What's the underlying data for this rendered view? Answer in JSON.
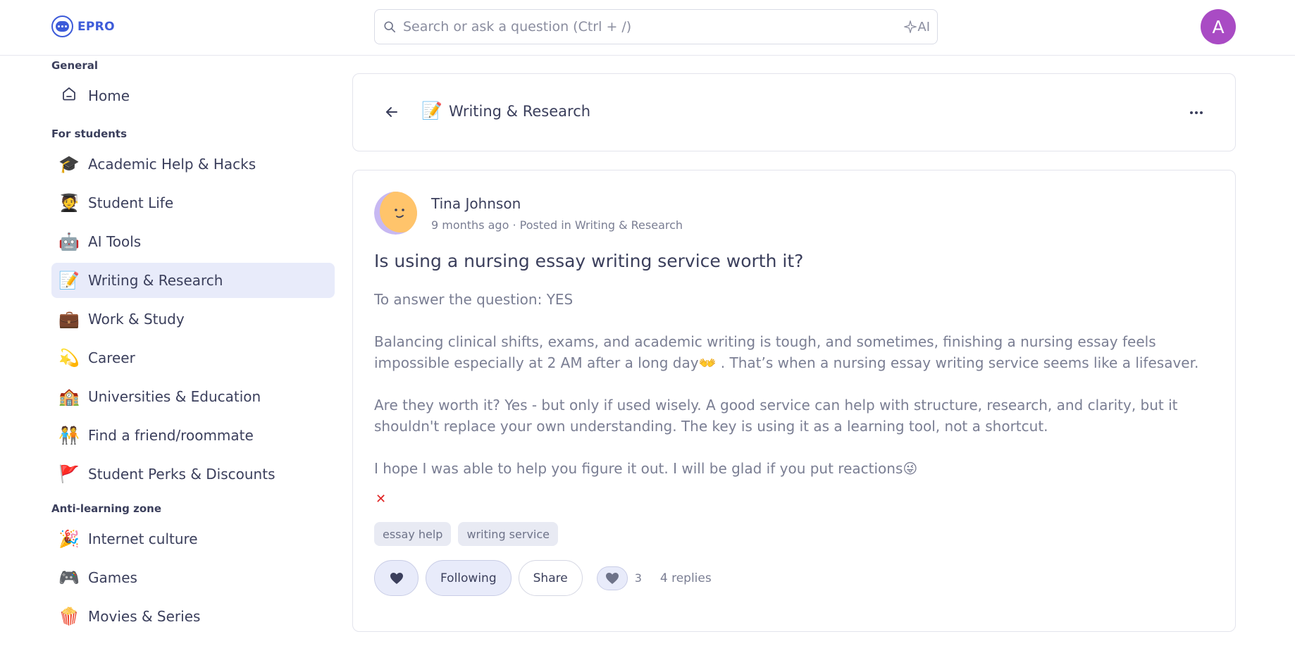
{
  "header": {
    "logo_text": "EPRO",
    "search_placeholder": "Search or ask a question (Ctrl + /)",
    "ai_label": "AI",
    "avatar_letter": "A",
    "avatar_color": "#a94bc4"
  },
  "sidebar": {
    "sections": [
      {
        "label": "General"
      },
      {
        "label": "For students"
      },
      {
        "label": "Anti-learning zone"
      }
    ],
    "items": [
      {
        "label": "Home",
        "icon": "home-icon"
      },
      {
        "label": "Academic Help & Hacks",
        "emoji": "🎓"
      },
      {
        "label": "Student Life",
        "emoji": "🧑‍🎓"
      },
      {
        "label": "AI Tools",
        "emoji": "🤖"
      },
      {
        "label": "Writing & Research",
        "emoji": "📝",
        "active": true
      },
      {
        "label": "Work & Study",
        "emoji": "💼"
      },
      {
        "label": "Career",
        "emoji": "💫"
      },
      {
        "label": "Universities & Education",
        "emoji": "🏫"
      },
      {
        "label": "Find a friend/roommate",
        "emoji": "🧑‍🤝‍🧑"
      },
      {
        "label": "Student Perks & Discounts",
        "emoji": "🚩"
      },
      {
        "label": "Internet culture",
        "emoji": "🎉"
      },
      {
        "label": "Games",
        "emoji": "🎮"
      },
      {
        "label": "Movies & Series",
        "emoji": "🍿"
      }
    ]
  },
  "channel": {
    "emoji": "📝",
    "title": "Writing & Research"
  },
  "post": {
    "author": "Tina Johnson",
    "meta": "9 months ago · Posted in Writing & Research",
    "title": "Is using a nursing essay writing service worth it?",
    "paragraphs": [
      "To answer the question: YES",
      "Balancing clinical shifts, exams, and academic writing is tough, and sometimes, finishing a nursing essay feels impossible especially at 2 AM after a long day👐 . That’s when a nursing essay writing service seems like a lifesaver.",
      "Are they worth it? Yes - but only if used wisely. A good service can help with structure, research, and clarity, but it shouldn't replace your own understanding. The key is using it as a learning tool, not a shortcut.",
      "I hope I was able to help you figure it out. I will be glad if you put reactions😜"
    ],
    "close_glyph": "✕",
    "tags": [
      "essay help",
      "writing service"
    ],
    "actions": {
      "following_label": "Following",
      "share_label": "Share",
      "reaction_count": "3",
      "replies_label": "4 replies"
    }
  },
  "colors": {
    "accent": "#3d5bd9",
    "active_bg": "#e8ebfa"
  }
}
